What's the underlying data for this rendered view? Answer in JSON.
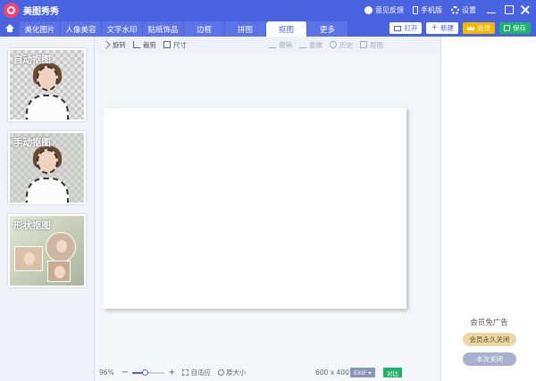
{
  "app": {
    "title": "美图秀秀"
  },
  "title_bar": {
    "feedback": "意见反馈",
    "mobile": "手机版",
    "settings": "设置"
  },
  "tabs": [
    {
      "label": "美化图片",
      "active": false
    },
    {
      "label": "人像美容",
      "active": false
    },
    {
      "label": "文字水印",
      "active": false
    },
    {
      "label": "贴纸饰品",
      "active": false
    },
    {
      "label": "边框",
      "active": false
    },
    {
      "label": "拼图",
      "active": false
    },
    {
      "label": "抠图",
      "active": true
    },
    {
      "label": "更多",
      "active": false
    }
  ],
  "actions": {
    "open": "打开",
    "new": "新建",
    "vip": "会员",
    "save": "保存"
  },
  "left_panel": {
    "cards": [
      {
        "label": "自动抠图"
      },
      {
        "label": "手动抠图"
      },
      {
        "label": "形状抠图"
      }
    ]
  },
  "toolbar": {
    "rotate": "旋转",
    "crop": "裁剪",
    "size": "尺寸",
    "undo": "撤销",
    "redo": "重做",
    "history": "历史",
    "original": "原图"
  },
  "bottom_bar": {
    "zoom": "96%",
    "zoom_percent": 40,
    "fit": "自适应",
    "original_size": "原大小",
    "dimensions": "600 x 400",
    "exif": "EXIF",
    "compare": "对比"
  },
  "right_panel": {
    "ad_title": "会员免广告",
    "close_permanent": "会员永久关闭",
    "close_once": "本次关闭"
  },
  "colors": {
    "accent": "#4a63e0",
    "save": "#1db36b",
    "vip": "#f5b800"
  }
}
